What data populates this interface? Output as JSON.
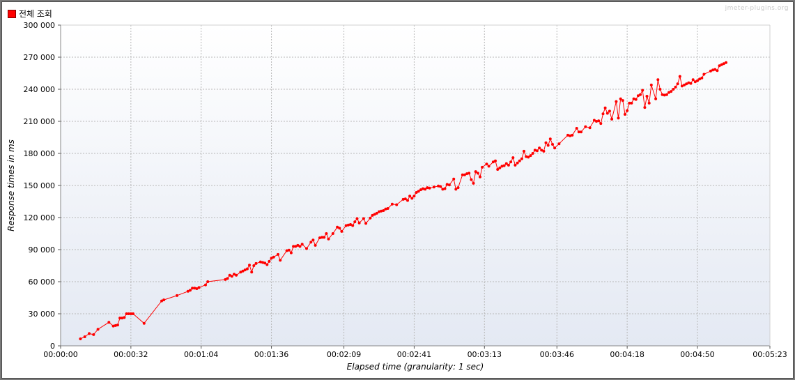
{
  "legend": {
    "label": "전체 조회",
    "color": "#ff0000"
  },
  "watermark": "jmeter-plugins.org",
  "chart_data": {
    "type": "line",
    "title": "",
    "xlabel": "Elapsed time (granularity: 1 sec)",
    "ylabel": "Response times in ms",
    "x_unit": "seconds",
    "xlim": [
      0,
      323
    ],
    "ylim": [
      0,
      300000
    ],
    "grid": true,
    "legend_position": "top-left",
    "x_ticks": [
      {
        "t": 0,
        "label": "00:00:00"
      },
      {
        "t": 32,
        "label": "00:00:32"
      },
      {
        "t": 64,
        "label": "00:01:04"
      },
      {
        "t": 96,
        "label": "00:01:36"
      },
      {
        "t": 129,
        "label": "00:02:09"
      },
      {
        "t": 161,
        "label": "00:02:41"
      },
      {
        "t": 193,
        "label": "00:03:13"
      },
      {
        "t": 226,
        "label": "00:03:46"
      },
      {
        "t": 258,
        "label": "00:04:18"
      },
      {
        "t": 290,
        "label": "00:04:50"
      },
      {
        "t": 323,
        "label": "00:05:23"
      }
    ],
    "y_ticks": [
      {
        "v": 0,
        "label": "0"
      },
      {
        "v": 30000,
        "label": "30 000"
      },
      {
        "v": 60000,
        "label": "60 000"
      },
      {
        "v": 90000,
        "label": "90 000"
      },
      {
        "v": 120000,
        "label": "120 000"
      },
      {
        "v": 150000,
        "label": "150 000"
      },
      {
        "v": 180000,
        "label": "180 000"
      },
      {
        "v": 210000,
        "label": "210 000"
      },
      {
        "v": 240000,
        "label": "240 000"
      },
      {
        "v": 270000,
        "label": "270 000"
      },
      {
        "v": 300000,
        "label": "300 000"
      }
    ],
    "series": [
      {
        "name": "전체 조회",
        "color": "#ff0000",
        "points": [
          [
            9,
            6500
          ],
          [
            11,
            8500
          ],
          [
            13,
            11500
          ],
          [
            15,
            10500
          ],
          [
            17,
            15500
          ],
          [
            22,
            22000
          ],
          [
            24,
            18500
          ],
          [
            25,
            19000
          ],
          [
            26,
            19500
          ],
          [
            27,
            26000
          ],
          [
            28,
            26000
          ],
          [
            29,
            26500
          ],
          [
            30,
            30000
          ],
          [
            31,
            30000
          ],
          [
            32,
            30000
          ],
          [
            33,
            30000
          ],
          [
            38,
            21000
          ],
          [
            46,
            42000
          ],
          [
            47,
            43000
          ],
          [
            53,
            47000
          ],
          [
            58,
            51000
          ],
          [
            59,
            52000
          ],
          [
            60,
            54000
          ],
          [
            61,
            54000
          ],
          [
            62,
            53500
          ],
          [
            63,
            54500
          ],
          [
            66,
            57000
          ],
          [
            67,
            60000
          ],
          [
            75,
            62000
          ],
          [
            76,
            63000
          ],
          [
            77,
            66000
          ],
          [
            78,
            65000
          ],
          [
            79,
            67000
          ],
          [
            80,
            66000
          ],
          [
            82,
            69000
          ],
          [
            83,
            70000
          ],
          [
            84,
            71000
          ],
          [
            85,
            72000
          ],
          [
            86,
            75500
          ],
          [
            87,
            69000
          ],
          [
            88,
            75000
          ],
          [
            89,
            77000
          ],
          [
            91,
            78500
          ],
          [
            92,
            78000
          ],
          [
            93,
            77500
          ],
          [
            94,
            76000
          ],
          [
            95,
            79000
          ],
          [
            96,
            82000
          ],
          [
            97,
            83000
          ],
          [
            99,
            85500
          ],
          [
            100,
            80000
          ],
          [
            103,
            89000
          ],
          [
            104,
            89500
          ],
          [
            105,
            87000
          ],
          [
            106,
            93000
          ],
          [
            107,
            93000
          ],
          [
            108,
            94000
          ],
          [
            109,
            93000
          ],
          [
            110,
            95000
          ],
          [
            112,
            91000
          ],
          [
            114,
            97000
          ],
          [
            115,
            99000
          ],
          [
            116,
            94000
          ],
          [
            118,
            101000
          ],
          [
            119,
            101500
          ],
          [
            120,
            101500
          ],
          [
            121,
            105000
          ],
          [
            122,
            100000
          ],
          [
            124,
            105000
          ],
          [
            126,
            111000
          ],
          [
            127,
            110000
          ],
          [
            128,
            107000
          ],
          [
            130,
            112500
          ],
          [
            131,
            113000
          ],
          [
            132,
            113500
          ],
          [
            133,
            112500
          ],
          [
            134,
            116000
          ],
          [
            135,
            119000
          ],
          [
            136,
            115000
          ],
          [
            138,
            119000
          ],
          [
            139,
            114500
          ],
          [
            141,
            119500
          ],
          [
            142,
            122000
          ],
          [
            143,
            123000
          ],
          [
            144,
            124000
          ],
          [
            145,
            125500
          ],
          [
            146,
            126000
          ],
          [
            147,
            126500
          ],
          [
            148,
            128000
          ],
          [
            149,
            128500
          ],
          [
            151,
            132500
          ],
          [
            153,
            132000
          ],
          [
            156,
            137000
          ],
          [
            157,
            137500
          ],
          [
            158,
            136000
          ],
          [
            159,
            140000
          ],
          [
            160,
            138000
          ],
          [
            161,
            140000
          ],
          [
            162,
            143500
          ],
          [
            163,
            144500
          ],
          [
            164,
            146000
          ],
          [
            165,
            147000
          ],
          [
            166,
            146500
          ],
          [
            167,
            148000
          ],
          [
            168,
            147500
          ],
          [
            170,
            148500
          ],
          [
            172,
            149500
          ],
          [
            173,
            149000
          ],
          [
            174,
            146500
          ],
          [
            175,
            147000
          ],
          [
            176,
            151000
          ],
          [
            177,
            150500
          ],
          [
            179,
            156000
          ],
          [
            180,
            146500
          ],
          [
            181,
            148000
          ],
          [
            183,
            160000
          ],
          [
            184,
            160000
          ],
          [
            185,
            161000
          ],
          [
            186,
            161500
          ],
          [
            187,
            155500
          ],
          [
            188,
            152000
          ],
          [
            189,
            163000
          ],
          [
            190,
            161500
          ],
          [
            191,
            158000
          ],
          [
            192,
            167000
          ],
          [
            194,
            170000
          ],
          [
            195,
            168000
          ],
          [
            197,
            172000
          ],
          [
            198,
            173000
          ],
          [
            199,
            165000
          ],
          [
            200,
            166500
          ],
          [
            201,
            168000
          ],
          [
            202,
            168500
          ],
          [
            203,
            170500
          ],
          [
            204,
            169000
          ],
          [
            205,
            172000
          ],
          [
            206,
            176000
          ],
          [
            207,
            169000
          ],
          [
            208,
            171000
          ],
          [
            209,
            173000
          ],
          [
            210,
            175000
          ],
          [
            211,
            182000
          ],
          [
            212,
            177000
          ],
          [
            213,
            176500
          ],
          [
            214,
            178000
          ],
          [
            215,
            180000
          ],
          [
            216,
            183000
          ],
          [
            217,
            182500
          ],
          [
            218,
            185000
          ],
          [
            219,
            183000
          ],
          [
            220,
            182000
          ],
          [
            221,
            190000
          ],
          [
            222,
            187500
          ],
          [
            223,
            193500
          ],
          [
            224,
            188500
          ],
          [
            225,
            185000
          ],
          [
            227,
            189000
          ],
          [
            231,
            197000
          ],
          [
            232,
            196500
          ],
          [
            233,
            197000
          ],
          [
            235,
            203500
          ],
          [
            236,
            200000
          ],
          [
            237,
            200000
          ],
          [
            239,
            205000
          ],
          [
            241,
            204000
          ],
          [
            243,
            211000
          ],
          [
            244,
            210000
          ],
          [
            245,
            210500
          ],
          [
            246,
            208000
          ],
          [
            247,
            217000
          ],
          [
            248,
            222500
          ],
          [
            249,
            217500
          ],
          [
            250,
            219500
          ],
          [
            251,
            212000
          ],
          [
            253,
            228500
          ],
          [
            254,
            213000
          ],
          [
            255,
            231000
          ],
          [
            256,
            229500
          ],
          [
            257,
            216500
          ],
          [
            258,
            220000
          ],
          [
            259,
            227000
          ],
          [
            260,
            227000
          ],
          [
            261,
            231000
          ],
          [
            262,
            230500
          ],
          [
            263,
            234000
          ],
          [
            264,
            235000
          ],
          [
            265,
            239000
          ],
          [
            266,
            223000
          ],
          [
            267,
            233500
          ],
          [
            268,
            227000
          ],
          [
            269,
            244000
          ],
          [
            271,
            231000
          ],
          [
            272,
            249000
          ],
          [
            273,
            240000
          ],
          [
            274,
            235000
          ],
          [
            275,
            234500
          ],
          [
            276,
            235000
          ],
          [
            277,
            237000
          ],
          [
            278,
            238000
          ],
          [
            279,
            240000
          ],
          [
            280,
            242000
          ],
          [
            281,
            245000
          ],
          [
            282,
            252000
          ],
          [
            283,
            243000
          ],
          [
            284,
            244000
          ],
          [
            285,
            245000
          ],
          [
            286,
            246000
          ],
          [
            287,
            245500
          ],
          [
            288,
            249000
          ],
          [
            289,
            247000
          ],
          [
            290,
            248000
          ],
          [
            291,
            249500
          ],
          [
            292,
            250500
          ],
          [
            293,
            254000
          ],
          [
            296,
            257000
          ],
          [
            297,
            258000
          ],
          [
            298,
            258500
          ],
          [
            299,
            257500
          ],
          [
            300,
            262000
          ],
          [
            301,
            263000
          ],
          [
            302,
            264000
          ],
          [
            303,
            265000
          ]
        ]
      }
    ]
  }
}
